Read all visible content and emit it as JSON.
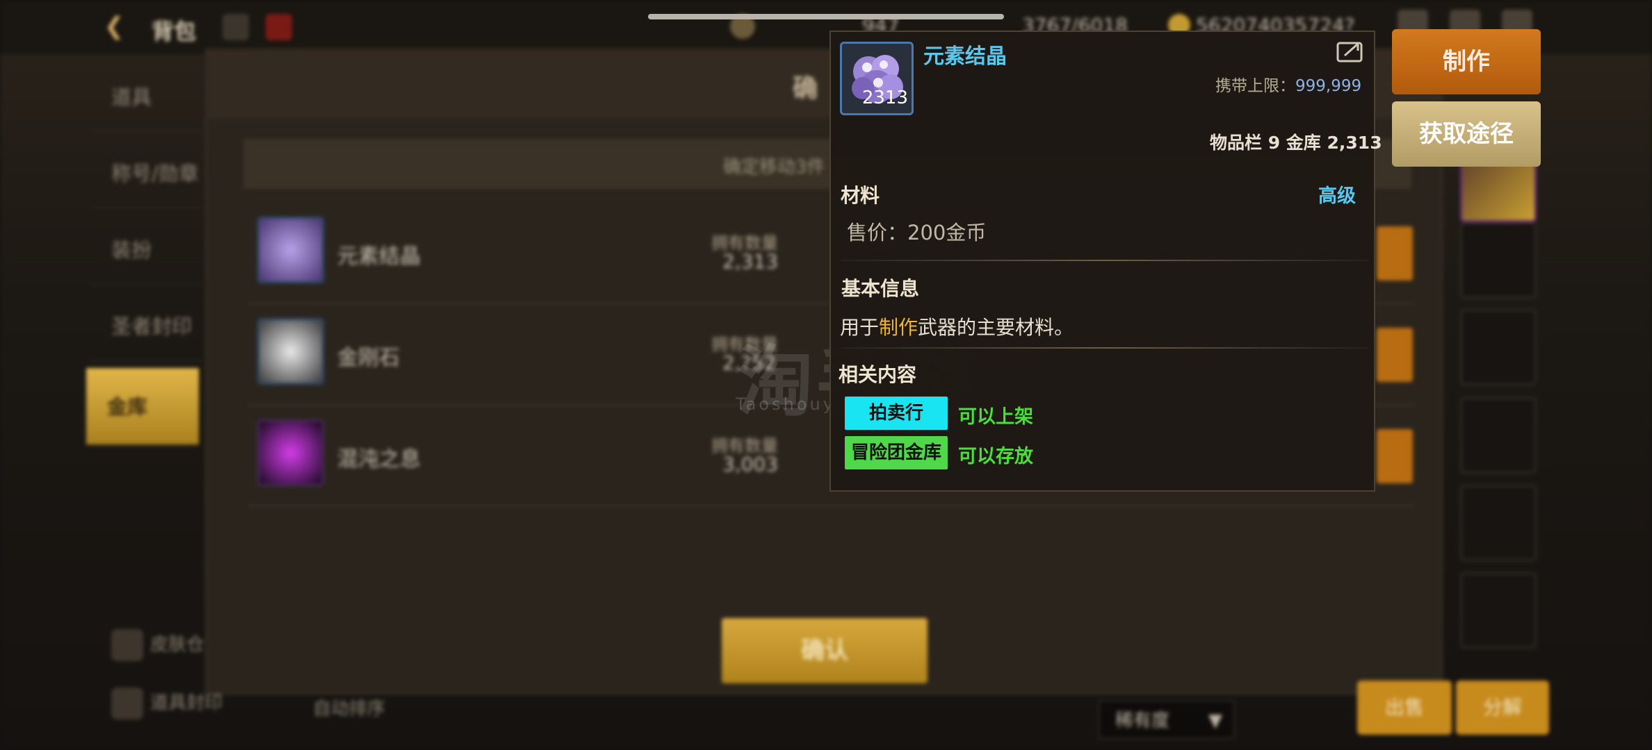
{
  "top_bar": {
    "title": "背包",
    "currency_1": "947",
    "currency_2": "3767/6018",
    "currency_3": "562074035724?"
  },
  "sidebar": {
    "items": [
      {
        "label": "道具"
      },
      {
        "label": "称号/勋章"
      },
      {
        "label": "装扮"
      },
      {
        "label": "圣者封印"
      },
      {
        "label": "金库"
      }
    ],
    "bottom_1": "皮肤仓",
    "bottom_2": "道具封印",
    "sort_label": "自动排序"
  },
  "dialog": {
    "title": "确",
    "confirm_prompt": "确定移动3件",
    "confirm_button": "确认",
    "qty_label": "拥有数量",
    "items": [
      {
        "name": "元素结晶",
        "qty": "2,313"
      },
      {
        "name": "金刚石",
        "qty": "2,?52"
      },
      {
        "name": "混沌之息",
        "qty": "3,003"
      }
    ]
  },
  "bottom_bar": {
    "sort_select": "稀有度",
    "sell_label": "出售",
    "disassemble_label": "分解"
  },
  "watermark": {
    "main": "淘手游",
    "sub": "Taoshouyou"
  },
  "tooltip": {
    "item_name": "元素结晶",
    "item_count": "2313",
    "carry_limit_label": "携带上限：",
    "carry_limit_value": "999,999",
    "stock_line": "物品栏 9 金库 2,313",
    "category": "材料",
    "grade": "高级",
    "price": "售价：200金币",
    "basic_info_title": "基本信息",
    "desc_prefix": "用于",
    "desc_highlight": "制作",
    "desc_suffix": "武器的主要材料。",
    "related_title": "相关内容",
    "tags": [
      {
        "label": "拍卖行",
        "note": "可以上架",
        "color": "#18e4f2"
      },
      {
        "label": "冒险团金库",
        "note": "可以存放",
        "color": "#4ed84a"
      }
    ]
  },
  "actions": {
    "make": "制作",
    "source": "获取途径"
  },
  "colors": {
    "accent_blue": "#58c9f0",
    "highlight_gold": "#f2b62b",
    "note_green": "#49e03a",
    "make_orange": "#c8690f"
  }
}
